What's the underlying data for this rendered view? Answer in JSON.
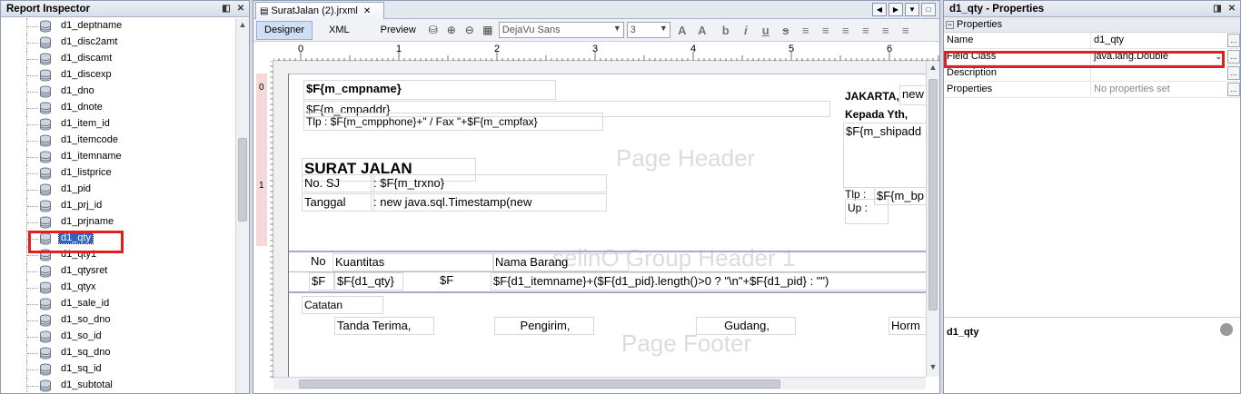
{
  "inspector": {
    "title": "Report Inspector",
    "items": [
      "d1_deptname",
      "d1_disc2amt",
      "d1_discamt",
      "d1_discexp",
      "d1_dno",
      "d1_dnote",
      "d1_item_id",
      "d1_itemcode",
      "d1_itemname",
      "d1_listprice",
      "d1_pid",
      "d1_prj_id",
      "d1_prjname",
      "d1_qty",
      "d1_qty1",
      "d1_qtysret",
      "d1_qtyx",
      "d1_sale_id",
      "d1_so_dno",
      "d1_so_id",
      "d1_sq_dno",
      "d1_sq_id",
      "d1_subtotal"
    ],
    "selected": "d1_qty"
  },
  "editor": {
    "tab": "SuratJalan (2).jrxml",
    "modes": [
      "Designer",
      "XML",
      "Preview"
    ],
    "font_name": "DejaVu Sans",
    "font_size": "3",
    "ruler_marks": [
      "0",
      "1",
      "2",
      "3",
      "4",
      "5",
      "6"
    ],
    "ruler_v_marks": [
      "0",
      "1"
    ],
    "bands": {
      "page_header": "Page Header",
      "group_header": "selinO Group Header 1",
      "page_footer": "Page Footer"
    },
    "fields": {
      "cmpname": "$F{m_cmpname}",
      "cmpaddr": "$F{m_cmpaddr}",
      "cmpphone": "Tlp : $F{m_cmpphone}+\" / Fax \"+$F{m_cmpfax}",
      "jakarta_label": "JAKARTA,",
      "jakarta_val": "new",
      "kepada": "Kepada Yth,",
      "shipaddr": "$F{m_shipadd",
      "surat_jalan": "SURAT JALAN",
      "no_sj_label": "No. SJ",
      "no_sj_val": ": $F{m_trxno}",
      "tanggal_label": "Tanggal",
      "tanggal_val": ": new java.sql.Timestamp(new",
      "tlp_label": "Tlp :",
      "up_label": "Up :",
      "bp_val": "$F{m_bp",
      "col_no": "No",
      "col_kuantitas": "Kuantitas",
      "col_nama_barang": "Nama Barang",
      "d_f1": "$F",
      "d_qty": "$F{d1_qty}",
      "d_f2": "$F",
      "d_item": "$F{d1_itemname}+($F{d1_pid}.length()>0 ? \"\\n\"+$F{d1_pid} : \"\")",
      "catatan": "Catatan",
      "tanda_terima": "Tanda Terima,",
      "pengirim": "Pengirim,",
      "gudang": "Gudang,",
      "hormat": "Horm"
    }
  },
  "properties": {
    "title": "d1_qty - Properties",
    "section": "Properties",
    "rows": [
      {
        "key": "Name",
        "value": "d1_qty"
      },
      {
        "key": "Field Class",
        "value": "java.lang.Double"
      },
      {
        "key": "Description",
        "value": ""
      },
      {
        "key": "Properties",
        "value": "No properties set"
      }
    ],
    "description_title": "d1_qty"
  }
}
